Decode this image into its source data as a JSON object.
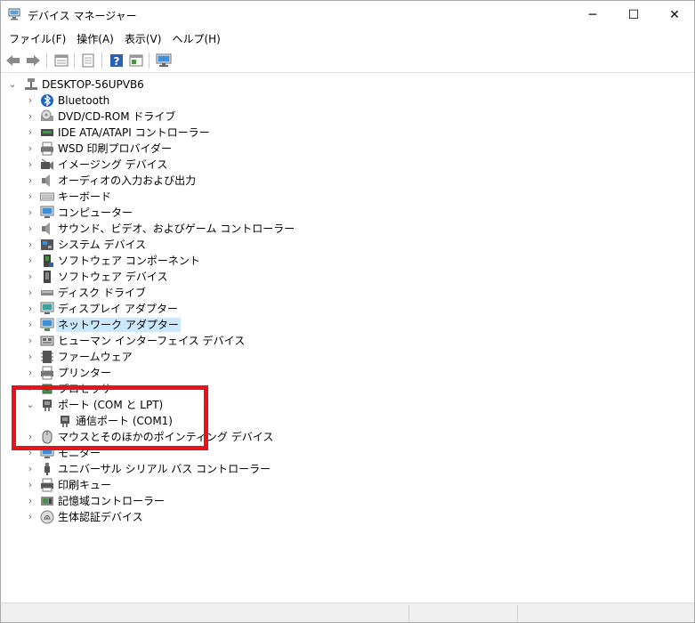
{
  "window": {
    "title": "デバイス マネージャー",
    "minimize_glyph": "─",
    "maximize_glyph": "☐",
    "close_glyph": "✕"
  },
  "menu": [
    "ファイル(F)",
    "操作(A)",
    "表示(V)",
    "ヘルプ(H)"
  ],
  "toolbar": {
    "buttons": [
      "back-icon",
      "forward-icon",
      "properties-view-icon",
      "update-icon",
      "help-icon",
      "action-icon",
      "monitor-icon"
    ]
  },
  "tree": {
    "root": "DESKTOP-56UPVB6",
    "categories": [
      {
        "label": "Bluetooth",
        "icon": "bluetooth-icon"
      },
      {
        "label": "DVD/CD-ROM ドライブ",
        "icon": "dvd-drive-icon"
      },
      {
        "label": "IDE ATA/ATAPI コントローラー",
        "icon": "ide-controller-icon"
      },
      {
        "label": "WSD 印刷プロバイダー",
        "icon": "printer-icon"
      },
      {
        "label": "イメージング デバイス",
        "icon": "camera-icon"
      },
      {
        "label": "オーディオの入力および出力",
        "icon": "speaker-icon"
      },
      {
        "label": "キーボード",
        "icon": "keyboard-icon"
      },
      {
        "label": "コンピューター",
        "icon": "computer-icon"
      },
      {
        "label": "サウンド、ビデオ、およびゲーム コントローラー",
        "icon": "speaker-icon"
      },
      {
        "label": "システム デバイス",
        "icon": "system-device-icon"
      },
      {
        "label": "ソフトウェア コンポーネント",
        "icon": "software-component-icon"
      },
      {
        "label": "ソフトウェア デバイス",
        "icon": "software-device-icon"
      },
      {
        "label": "ディスク ドライブ",
        "icon": "disk-drive-icon"
      },
      {
        "label": "ディスプレイ アダプター",
        "icon": "display-adapter-icon"
      },
      {
        "label": "ネットワーク アダプター",
        "icon": "network-adapter-icon"
      },
      {
        "label": "ヒューマン インターフェイス デバイス",
        "icon": "hid-icon"
      },
      {
        "label": "ファームウェア",
        "icon": "firmware-icon"
      },
      {
        "label": "プリンター",
        "icon": "printer-icon"
      },
      {
        "label": "プロセッサ",
        "icon": "processor-icon"
      },
      {
        "label": "ポート (COM と LPT)",
        "icon": "port-icon",
        "expanded": true
      },
      {
        "label": "通信ポート (COM1)",
        "icon": "port-icon",
        "child": true
      },
      {
        "label": "マウスとそのほかのポインティング デバイス",
        "icon": "mouse-icon"
      },
      {
        "label": "モニター",
        "icon": "monitor-icon"
      },
      {
        "label": "ユニバーサル シリアル バス コントローラー",
        "icon": "usb-icon"
      },
      {
        "label": "印刷キュー",
        "icon": "print-queue-icon"
      },
      {
        "label": "記憶域コントローラー",
        "icon": "storage-controller-icon"
      },
      {
        "label": "生体認証デバイス",
        "icon": "biometric-icon"
      }
    ],
    "expand_glyph": "›",
    "collapse_glyph": "⌄"
  },
  "colors": {
    "highlight": "#e8121b",
    "selection": "#cce8ff"
  }
}
